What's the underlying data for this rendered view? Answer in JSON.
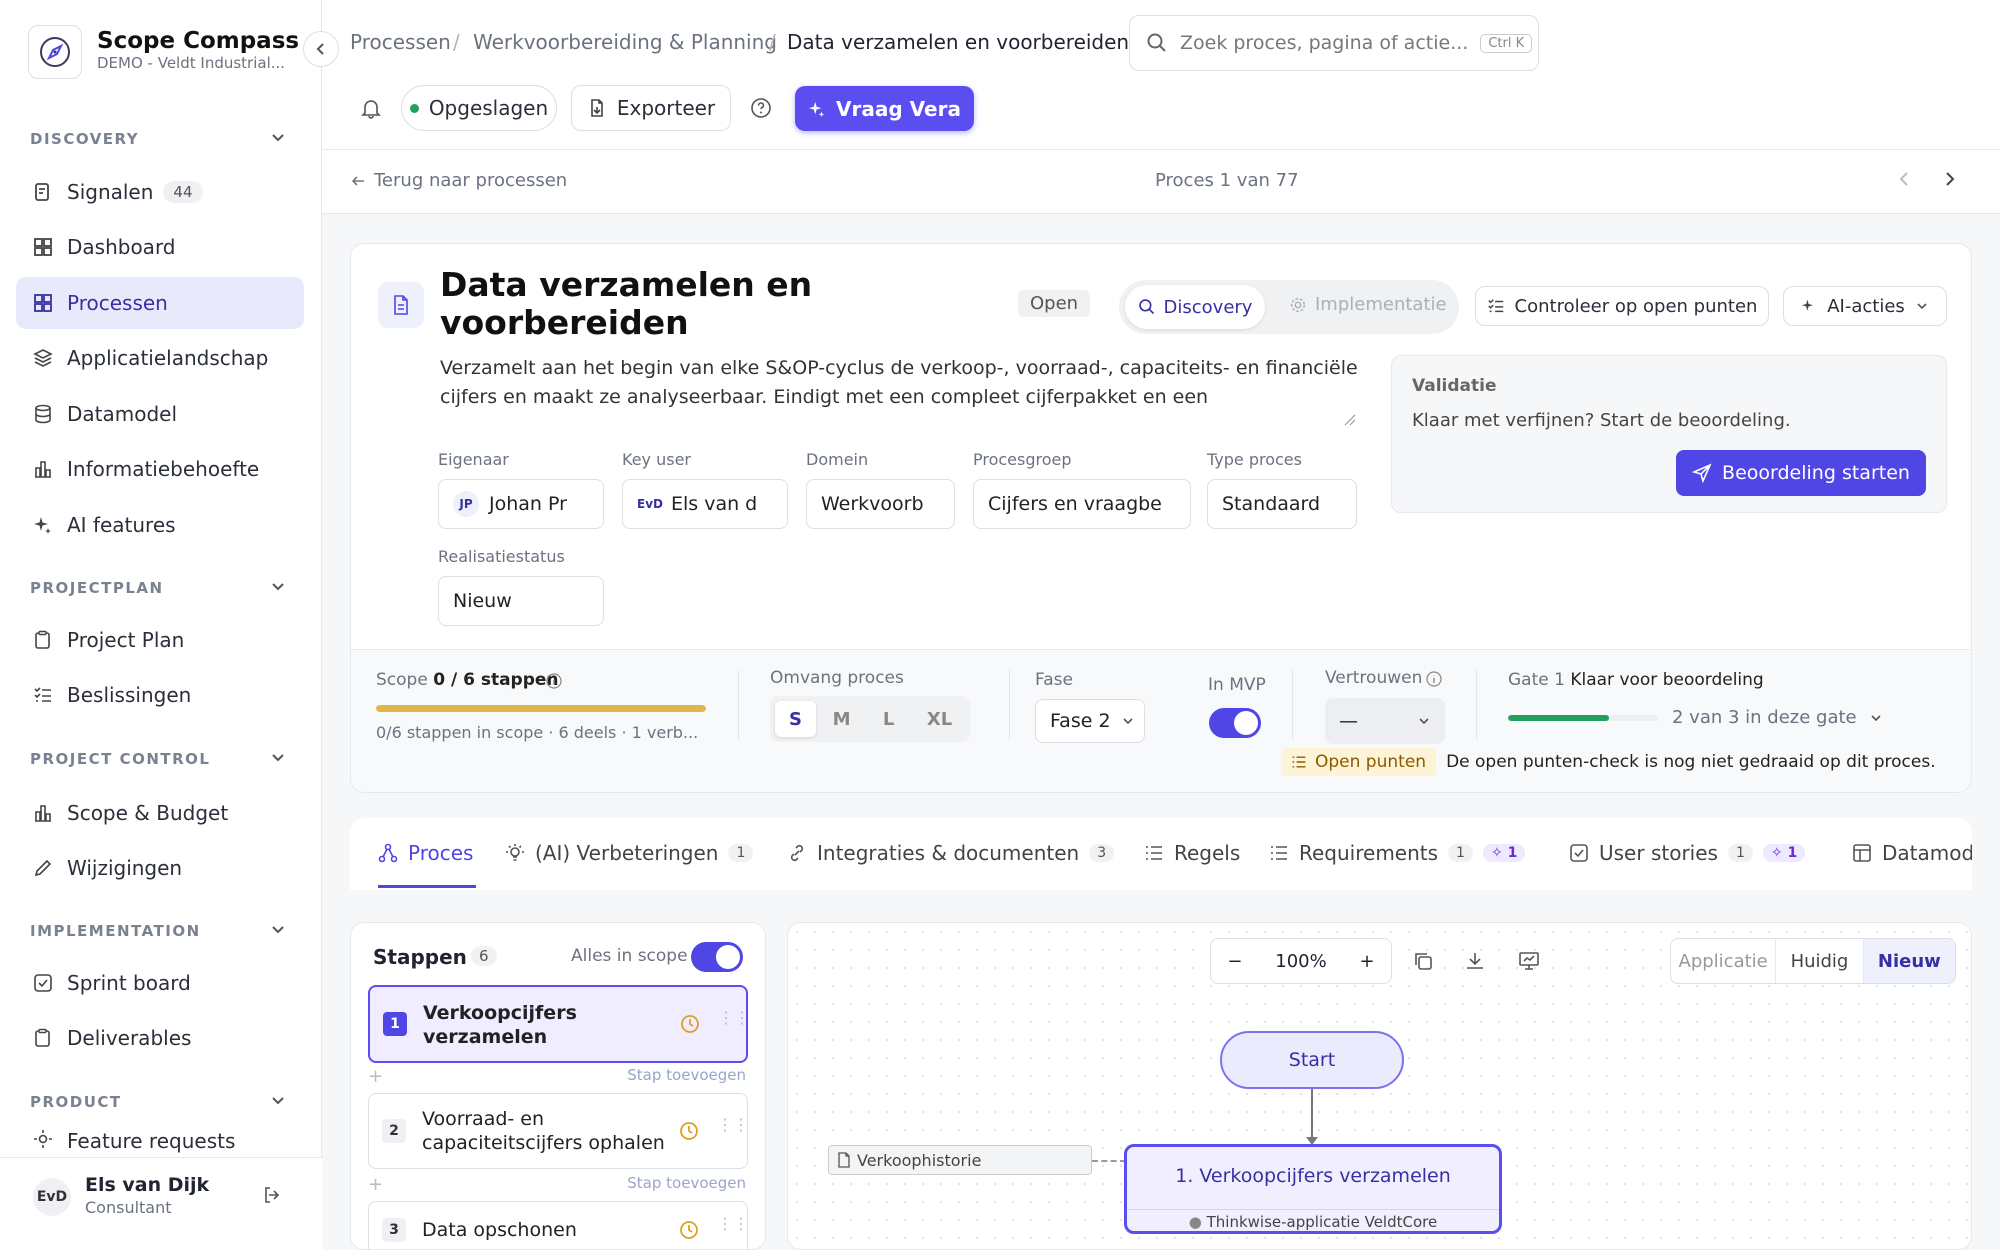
{
  "app": {
    "name": "Scope Compass",
    "org": "DEMO - Veldt Industrial..."
  },
  "sidebar": {
    "sections": [
      {
        "title": "DISCOVERY"
      },
      {
        "title": "PROJECTPLAN"
      },
      {
        "title": "PROJECT CONTROL"
      },
      {
        "title": "IMPLEMENTATION"
      },
      {
        "title": "PRODUCT"
      }
    ],
    "items": [
      {
        "label": "Signalen",
        "badge": "44"
      },
      {
        "label": "Dashboard"
      },
      {
        "label": "Processen"
      },
      {
        "label": "Applicatielandschap"
      },
      {
        "label": "Datamodel"
      },
      {
        "label": "Informatiebehoefte"
      },
      {
        "label": "AI features"
      },
      {
        "label": "Project Plan"
      },
      {
        "label": "Beslissingen"
      },
      {
        "label": "Scope & Budget"
      },
      {
        "label": "Wijzigingen"
      },
      {
        "label": "Sprint board"
      },
      {
        "label": "Deliverables"
      },
      {
        "label": "Feature requests"
      }
    ],
    "user": {
      "initials": "EvD",
      "name": "Els van Dijk",
      "role": "Consultant"
    }
  },
  "breadcrumb": [
    "Processen",
    "Werkvoorbereiding & Planning",
    "Data verzamelen en voorbereiden"
  ],
  "search": {
    "placeholder": "Zoek proces, pagina of actie...",
    "shortcut": "Ctrl K"
  },
  "toolbar": {
    "saved": "Opgeslagen",
    "export": "Exporteer",
    "ask": "Vraag Vera"
  },
  "subbar": {
    "back": "Terug naar processen",
    "counter": "Proces 1 van 77"
  },
  "process": {
    "title": "Data verzamelen en voorbereiden",
    "status": "Open",
    "mode_on": "Discovery",
    "mode_off": "Implementatie",
    "check_btn": "Controleer op open punten",
    "ai_btn": "AI-acties",
    "description": "Verzamelt aan het begin van elke S&OP-cyclus de verkoop-, voorraad-, capaciteits- en financiële cijfers en maakt ze analyseerbaar. Eindigt met een compleet cijferpakket en een basisvoorspelling.",
    "fields": {
      "owner_label": "Eigenaar",
      "owner_initials": "JP",
      "owner": "Johan Pr",
      "keyuser_label": "Key user",
      "keyuser_initials": "EvD",
      "keyuser": "Els van d",
      "domain_label": "Domein",
      "domain": "Werkvoorb",
      "group_label": "Procesgroep",
      "group": "Cijfers en vraagbe",
      "type_label": "Type proces",
      "type": "Standaard",
      "real_label": "Realisatiestatus",
      "real": "Nieuw"
    },
    "validation": {
      "title": "Validatie",
      "text": "Klaar met verfijnen? Start de beoordeling.",
      "button": "Beoordeling starten"
    }
  },
  "metrics": {
    "scope_label": "Scope",
    "scope_value": "0 / 6 stappen",
    "scope_sub": "0/6 stappen in scope · 6 deels · 1 verb...",
    "scope_fill": 1.0,
    "size_label": "Omvang proces",
    "sizes": [
      "S",
      "M",
      "L",
      "XL"
    ],
    "size_selected": "S",
    "phase_label": "Fase",
    "phase": "Fase 2",
    "mvp_label": "In MVP",
    "mvp": true,
    "trust_label": "Vertrouwen",
    "trust": "—",
    "gate_label": "Gate 1",
    "gate_status": "Klaar voor beoordeling",
    "gate_progress": "2 van 3 in deze gate",
    "gate_fill": 0.67,
    "open_badge": "Open punten",
    "open_text": "De open punten-check is nog niet gedraaid op dit proces."
  },
  "tabs": [
    {
      "label": "Proces"
    },
    {
      "label": "(AI) Verbeteringen",
      "count": "1"
    },
    {
      "label": "Integraties & documenten",
      "count": "3"
    },
    {
      "label": "Regels"
    },
    {
      "label": "Requirements",
      "count": "1",
      "ai": "1"
    },
    {
      "label": "User stories",
      "count": "1",
      "ai": "1"
    },
    {
      "label": "Datamodel"
    }
  ],
  "steps_panel": {
    "title": "Stappen",
    "count": "6",
    "all_label": "Alles in scope",
    "add_label": "Stap toevoegen",
    "steps": [
      {
        "num": "1",
        "label": "Verkoopcijfers verzamelen"
      },
      {
        "num": "2",
        "label": "Voorraad- en capaciteitscijfers ophalen"
      },
      {
        "num": "3",
        "label": "Data opschonen"
      }
    ]
  },
  "canvas": {
    "zoom": "100%",
    "views": [
      "Applicatie",
      "Huidig",
      "Nieuw"
    ],
    "start": "Start",
    "node": "1. Verkoopcijfers verzamelen",
    "node_app": "Thinkwise-applicatie VeldtCore",
    "doc": "Verkoophistorie"
  },
  "colors": {
    "accent": "#4f46e5",
    "scope_bar": "#e0b64a",
    "gate_bar": "#22a05b"
  }
}
